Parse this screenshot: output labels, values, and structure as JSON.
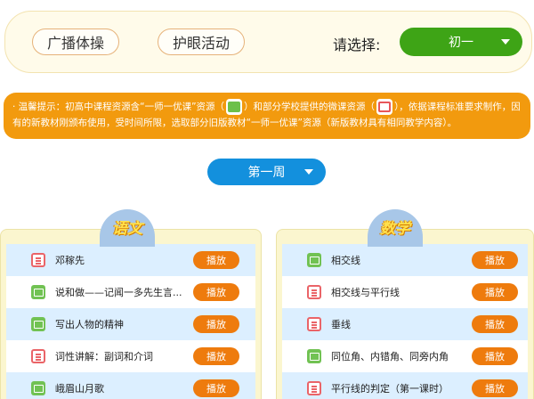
{
  "top": {
    "buttons": [
      "广播体操",
      "护眼活动"
    ],
    "select_label": "请选择:",
    "grade": "初一"
  },
  "notice": {
    "part1": "· 温馨提示：初高中课程资源含“一师一优课”资源（",
    "part2": "）和部分学校提供的微课资源（",
    "part3": "），依据课程标准要求制作，因有的新教材刚颁布使用，受时间所限，选取部分旧版教材“一师一优课”资源（新版教材具有相同教学内容）。"
  },
  "week": "第一周",
  "subjects": {
    "left": "语文",
    "right": "数学"
  },
  "play_label": "播放",
  "left_rows": [
    {
      "title": "邓稼先",
      "icon": "doc-icon"
    },
    {
      "title": "说和做——记闻一多先生言...",
      "icon": "video-icon"
    },
    {
      "title": "写出人物的精神",
      "icon": "video-icon"
    },
    {
      "title": "词性讲解：副词和介词",
      "icon": "doc-icon"
    },
    {
      "title": "峨眉山月歌",
      "icon": "video-icon"
    }
  ],
  "right_rows": [
    {
      "title": "相交线",
      "icon": "video-icon"
    },
    {
      "title": "相交线与平行线",
      "icon": "doc-icon"
    },
    {
      "title": "垂线",
      "icon": "doc-icon"
    },
    {
      "title": "同位角、内错角、同旁内角",
      "icon": "video-icon"
    },
    {
      "title": "平行线的判定（第一课时）",
      "icon": "doc-icon"
    }
  ]
}
